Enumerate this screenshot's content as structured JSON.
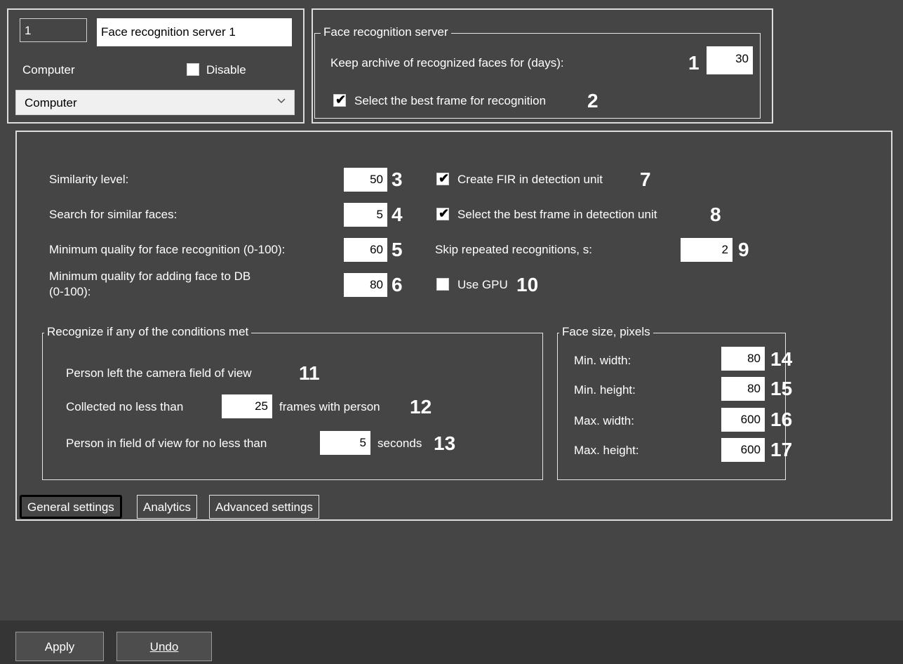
{
  "server": {
    "id_value": "1",
    "name_value": "Face recognition server 1",
    "computer_label": "Computer",
    "disable_label": "Disable",
    "disable_checked": false,
    "computer_select_value": "Computer"
  },
  "face_recognition_server": {
    "title": "Face recognition server",
    "keep_archive_label": "Keep archive of recognized faces for (days):",
    "keep_archive_value": "30",
    "keep_archive_marker": "1",
    "best_frame_label": "Select the best frame for recognition",
    "best_frame_checked": true,
    "best_frame_marker": "2"
  },
  "general": {
    "similarity_label": "Similarity level:",
    "similarity_value": "50",
    "similarity_marker": "3",
    "search_similar_label": "Search for similar faces:",
    "search_similar_value": "5",
    "search_similar_marker": "4",
    "min_quality_recog_label": "Minimum quality for face recognition (0-100):",
    "min_quality_recog_value": "60",
    "min_quality_recog_marker": "5",
    "min_quality_db_label_line1": "Minimum quality for adding face to DB",
    "min_quality_db_label_line2": "(0-100):",
    "min_quality_db_value": "80",
    "min_quality_db_marker": "6",
    "create_fir_label": "Create FIR in detection unit",
    "create_fir_checked": true,
    "create_fir_marker": "7",
    "best_frame_detect_label": "Select the best frame in detection unit",
    "best_frame_detect_checked": true,
    "best_frame_detect_marker": "8",
    "skip_repeated_label": "Skip repeated recognitions, s:",
    "skip_repeated_value": "2",
    "skip_repeated_marker": "9",
    "use_gpu_label": "Use GPU",
    "use_gpu_checked": false,
    "use_gpu_marker": "10"
  },
  "conditions": {
    "title": "Recognize if any of the conditions met",
    "left_fov_label": "Person left the camera field of view",
    "left_fov_marker": "11",
    "collected_prefix": "Collected no less than",
    "collected_value": "25",
    "collected_suffix": "frames with person",
    "collected_marker": "12",
    "in_fov_prefix": "Person in field of view for no less than",
    "in_fov_value": "5",
    "in_fov_suffix": "seconds",
    "in_fov_marker": "13"
  },
  "face_size": {
    "title": "Face size, pixels",
    "min_width_label": "Min. width:",
    "min_width_value": "80",
    "min_width_marker": "14",
    "min_height_label": "Min. height:",
    "min_height_value": "80",
    "min_height_marker": "15",
    "max_width_label": "Max. width:",
    "max_width_value": "600",
    "max_width_marker": "16",
    "max_height_label": "Max. height:",
    "max_height_value": "600",
    "max_height_marker": "17"
  },
  "tabs": [
    {
      "label": "General settings",
      "active": true
    },
    {
      "label": "Analytics",
      "active": false
    },
    {
      "label": "Advanced settings",
      "active": false
    }
  ],
  "footer": {
    "apply_label": "Apply",
    "undo_label": "Undo"
  },
  "icons": {
    "checkmark": "checkmark-icon",
    "dropdown": "chevron-down-icon"
  }
}
